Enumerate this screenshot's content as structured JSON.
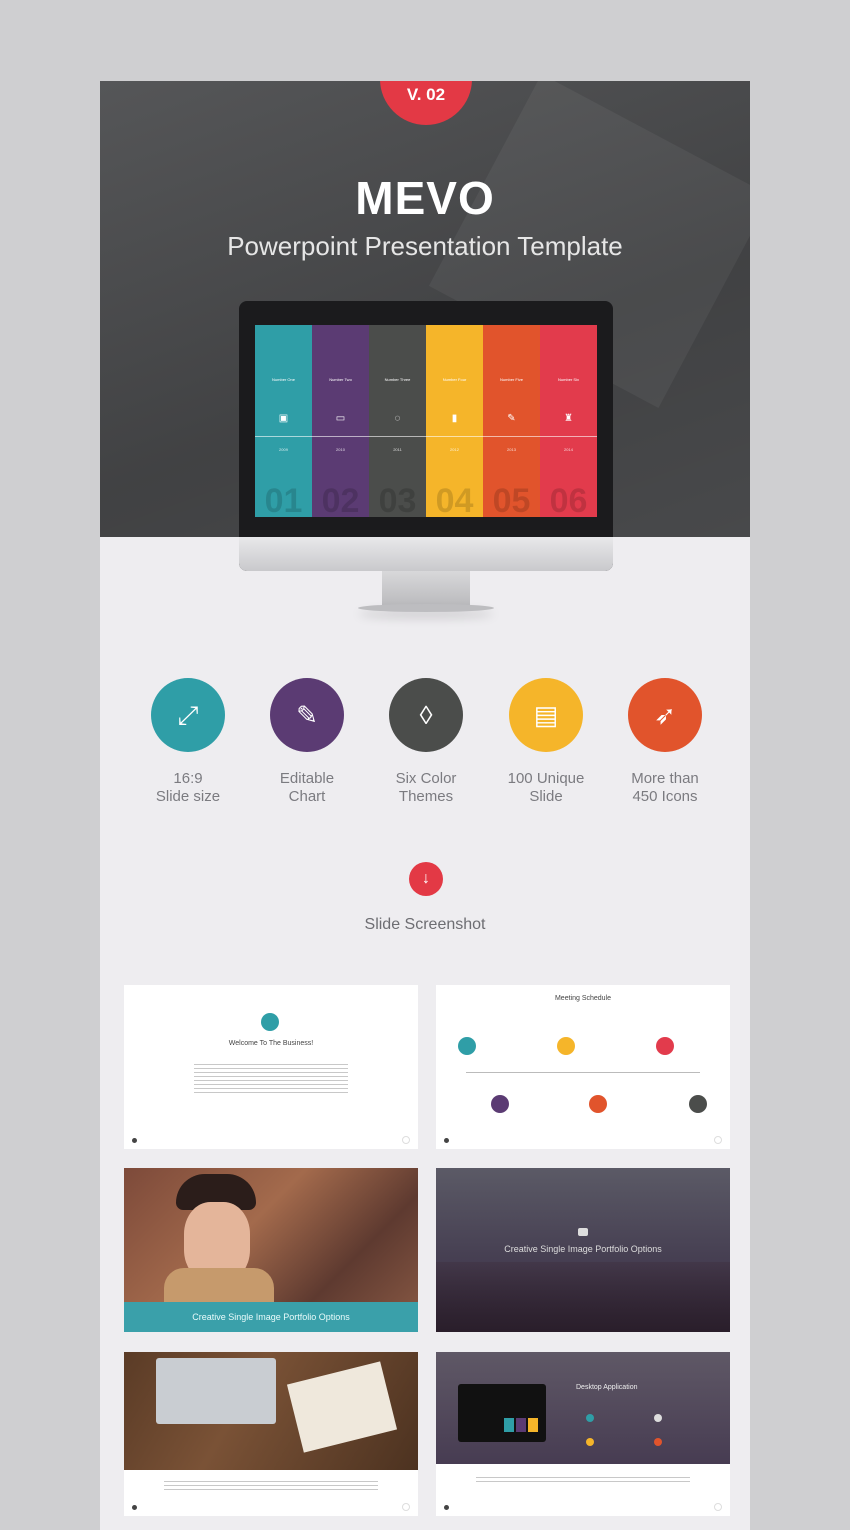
{
  "hero": {
    "version_badge": "V. 02",
    "title": "MEVO",
    "subtitle": "Powerpoint Presentation Template"
  },
  "monitor_slide": {
    "columns": [
      {
        "label": "Number One",
        "icon": "briefcase-icon",
        "glyph": "▣",
        "year": "2009",
        "number": "01",
        "color": "#2f9ea7"
      },
      {
        "label": "Number Two",
        "icon": "monitor-icon",
        "glyph": "▭",
        "year": "2010",
        "number": "02",
        "color": "#5b3b73"
      },
      {
        "label": "Number Three",
        "icon": "lightbulb-icon",
        "glyph": "◌",
        "year": "2011",
        "number": "03",
        "color": "#4b4d4b"
      },
      {
        "label": "Number Four",
        "icon": "bar-chart-icon",
        "glyph": "▮",
        "year": "2012",
        "number": "04",
        "color": "#f5b52a"
      },
      {
        "label": "Number Five",
        "icon": "pencil-icon",
        "glyph": "✎",
        "year": "2013",
        "number": "05",
        "color": "#e1542c"
      },
      {
        "label": "Number Six",
        "icon": "trophy-icon",
        "glyph": "♜",
        "year": "2014",
        "number": "06",
        "color": "#e23b4c"
      }
    ]
  },
  "features": [
    {
      "label_line1": "16:9",
      "label_line2": "Slide size",
      "icon": "expand-icon",
      "glyph": "⤢",
      "color": "#2f9ea7"
    },
    {
      "label_line1": "Editable",
      "label_line2": "Chart",
      "icon": "pencil-icon",
      "glyph": "✎",
      "color": "#5b3b73"
    },
    {
      "label_line1": "Six Color",
      "label_line2": "Themes",
      "icon": "droplet-icon",
      "glyph": "◊",
      "color": "#4b4d4b"
    },
    {
      "label_line1": "100 Unique",
      "label_line2": "Slide",
      "icon": "document-icon",
      "glyph": "▤",
      "color": "#f5b52a"
    },
    {
      "label_line1": "More than",
      "label_line2": "450 Icons",
      "icon": "rocket-icon",
      "glyph": "➶",
      "color": "#e1542c"
    }
  ],
  "screenshots": {
    "section_title": "Slide Screenshot",
    "slides": [
      {
        "title": "Welcome To The Business!"
      },
      {
        "title": "Meeting Schedule"
      },
      {
        "title": "Creative Single Image Portfolio Options"
      },
      {
        "title": "Creative Single Image Portfolio Options"
      },
      {
        "title": ""
      },
      {
        "title": "Desktop Application"
      }
    ]
  },
  "colors": {
    "accent_red": "#e33945",
    "teal": "#2f9ea7"
  }
}
